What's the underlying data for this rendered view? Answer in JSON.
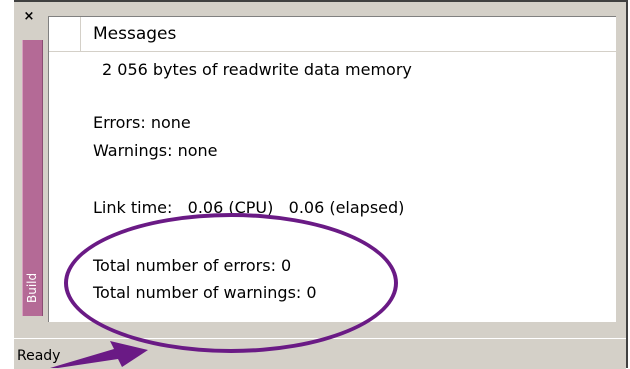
{
  "panel": {
    "close_glyph": "×",
    "tab_label": "Build",
    "header": "Messages"
  },
  "messages": {
    "line1": "2 056 bytes of readwrite data memory",
    "errors": "Errors: none",
    "warnings": "Warnings: none",
    "link_time": "Link time:   0.06 (CPU)   0.06 (elapsed)",
    "total_errors": "Total number of errors: 0",
    "total_warnings": "Total number of warnings: 0"
  },
  "status": {
    "text": "Ready"
  },
  "colors": {
    "highlight": "#6a1a85",
    "tab": "#b46a96"
  }
}
